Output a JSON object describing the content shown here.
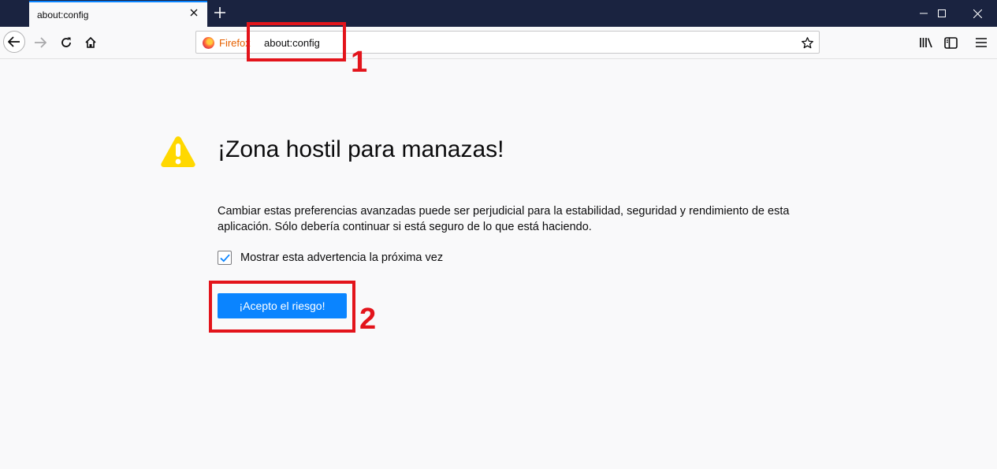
{
  "tab": {
    "title": "about:config"
  },
  "urlbar": {
    "identity_label": "Firefox",
    "url": "about:config"
  },
  "page": {
    "title": "¡Zona hostil para manazas!",
    "description": "Cambiar estas preferencias avanzadas puede ser perjudicial para la estabilidad, seguridad y rendimiento de esta aplicación. Sólo debería continuar si está seguro de lo que está haciendo.",
    "checkbox_label": "Mostrar esta advertencia la próxima vez",
    "checkbox_checked": true,
    "accept_button": "¡Acepto el riesgo!"
  },
  "annotations": [
    {
      "label": "1"
    },
    {
      "label": "2"
    }
  ],
  "colors": {
    "accent": "#0a84ff",
    "titlebar": "#1a2340",
    "annotation_red": "#e3141b",
    "warning_yellow": "#ffd800"
  },
  "icons": [
    "close-icon",
    "plus-icon",
    "minimize-icon",
    "maximize-icon",
    "back-arrow-icon",
    "forward-arrow-icon",
    "reload-icon",
    "home-icon",
    "firefox-logo-icon",
    "star-icon",
    "library-icon",
    "sidebar-icon",
    "menu-icon",
    "warning-icon",
    "checkmark-icon"
  ]
}
